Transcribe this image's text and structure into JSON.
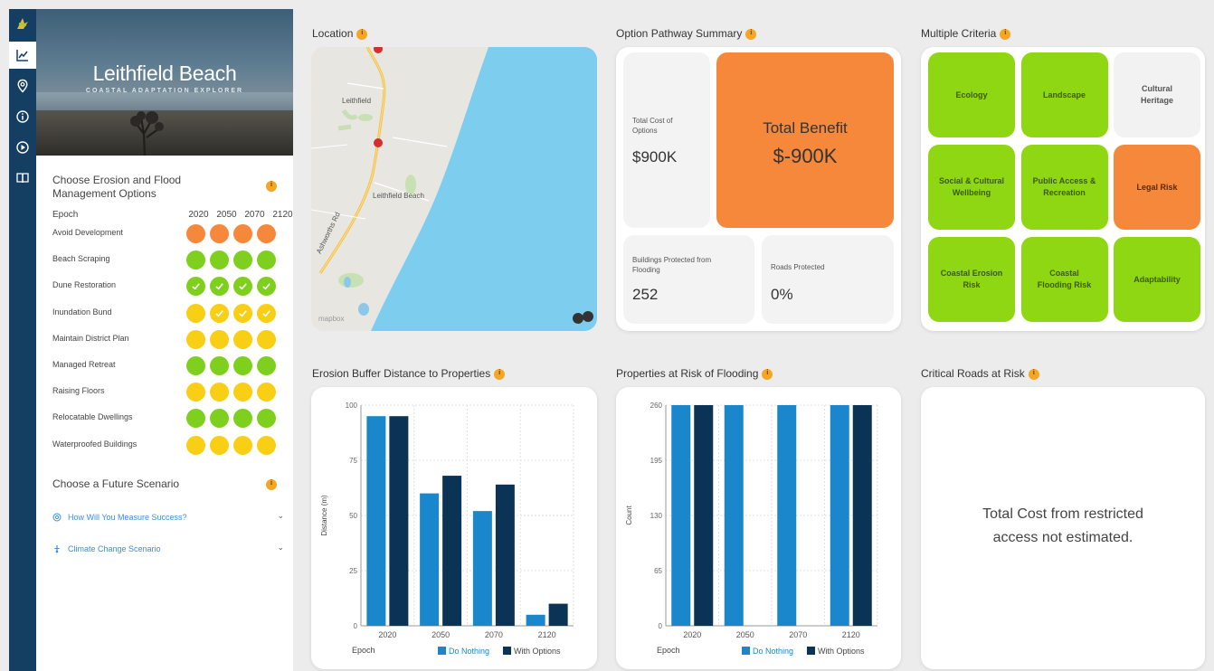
{
  "app": {
    "title": "Leithfield Beach",
    "subtitle": "COASTAL ADAPTATION EXPLORER"
  },
  "rail": {
    "icons": [
      "logo-icon",
      "chart-icon",
      "location-pin-icon",
      "info-icon",
      "play-icon",
      "book-icon"
    ],
    "active": "chart-icon"
  },
  "options_section": {
    "title_line1": "Choose Erosion and Flood",
    "title_line2": "Management Options",
    "epoch_label": "Epoch",
    "epochs": [
      "2020",
      "2050",
      "2070",
      "2120"
    ],
    "rows": [
      {
        "label": "Avoid Development",
        "dots": [
          "orange",
          "orange",
          "orange",
          "orange"
        ],
        "checked": [
          false,
          false,
          false,
          false
        ]
      },
      {
        "label": "Beach Scraping",
        "dots": [
          "green",
          "green",
          "green",
          "green"
        ],
        "checked": [
          false,
          false,
          false,
          false
        ]
      },
      {
        "label": "Dune Restoration",
        "dots": [
          "green",
          "green",
          "green",
          "green"
        ],
        "checked": [
          true,
          true,
          true,
          true
        ]
      },
      {
        "label": "Inundation Bund",
        "dots": [
          "yellow",
          "yellow",
          "yellow",
          "yellow"
        ],
        "checked": [
          false,
          true,
          true,
          true
        ]
      },
      {
        "label": "Maintain District Plan",
        "dots": [
          "yellow",
          "yellow",
          "yellow",
          "yellow"
        ],
        "checked": [
          false,
          false,
          false,
          false
        ]
      },
      {
        "label": "Managed Retreat",
        "dots": [
          "green",
          "green",
          "green",
          "green"
        ],
        "checked": [
          false,
          false,
          false,
          false
        ]
      },
      {
        "label": "Raising Floors",
        "dots": [
          "yellow",
          "yellow",
          "yellow",
          "yellow"
        ],
        "checked": [
          false,
          false,
          false,
          false
        ]
      },
      {
        "label": "Relocatable Dwellings",
        "dots": [
          "green",
          "green",
          "green",
          "green"
        ],
        "checked": [
          false,
          false,
          false,
          false
        ]
      },
      {
        "label": "Waterproofed Buildings",
        "dots": [
          "yellow",
          "yellow",
          "yellow",
          "yellow"
        ],
        "checked": [
          false,
          false,
          false,
          false
        ]
      }
    ],
    "colors": {
      "orange": "#f5883b",
      "green": "#7fcf1f",
      "yellow": "#f8cf14"
    }
  },
  "scenario_section": {
    "title": "Choose a Future Scenario",
    "items": [
      {
        "label": "How Will You Measure Success?",
        "icon": "target-icon"
      },
      {
        "label": "Climate Change Scenario",
        "icon": "thermometer-icon"
      }
    ]
  },
  "location": {
    "title": "Location",
    "places": [
      "Leithfield",
      "Leithfield Beach",
      "Ashworths Rd"
    ],
    "attribution": "mapbox"
  },
  "summary": {
    "title": "Option Pathway Summary",
    "total_cost_label": "Total Cost of Options",
    "total_cost_value": "$900K",
    "total_benefit_label": "Total Benefit",
    "total_benefit_value": "$-900K",
    "buildings_label": "Buildings Protected from Flooding",
    "buildings_value": "252",
    "roads_label": "Roads Protected",
    "roads_value": "0%"
  },
  "criteria": {
    "title": "Multiple Criteria",
    "items": [
      {
        "label": "Ecology",
        "status": "green"
      },
      {
        "label": "Landscape",
        "status": "green"
      },
      {
        "label": "Cultural Heritage",
        "status": "neutral"
      },
      {
        "label": "Social & Cultural Wellbeing",
        "status": "green"
      },
      {
        "label": "Public Access & Recreation",
        "status": "green"
      },
      {
        "label": "Legal Risk",
        "status": "orange"
      },
      {
        "label": "Coastal Erosion Risk",
        "status": "green"
      },
      {
        "label": "Coastal Flooding Risk",
        "status": "green"
      },
      {
        "label": "Adaptability",
        "status": "green"
      }
    ]
  },
  "erosion_chart_title": "Erosion Buffer Distance to Properties",
  "flooding_chart_title": "Properties at Risk of Flooding",
  "roads": {
    "title": "Critical Roads at Risk",
    "message_line1": "Total Cost from restricted",
    "message_line2": "access not estimated."
  },
  "chart_data": [
    {
      "type": "bar",
      "categories": [
        "2020",
        "2050",
        "2070",
        "2120"
      ],
      "series": [
        {
          "name": "Do Nothing",
          "values": [
            95,
            60,
            52,
            5
          ],
          "color": "#1a87cc"
        },
        {
          "name": "With Options",
          "values": [
            95,
            68,
            64,
            10
          ],
          "color": "#0b3355"
        }
      ],
      "xlabel": "Epoch",
      "ylabel": "Distance (m)",
      "ylim": [
        0,
        100
      ],
      "yticks": [
        0,
        25,
        50,
        75,
        100
      ],
      "legend": "bottom-right",
      "grid": true
    },
    {
      "type": "bar",
      "categories": [
        "2020",
        "2050",
        "2070",
        "2120"
      ],
      "series": [
        {
          "name": "Do Nothing",
          "values": [
            260,
            260,
            260,
            260
          ],
          "color": "#1a87cc"
        },
        {
          "name": "With Options",
          "values": [
            260,
            0,
            0,
            260
          ],
          "color": "#0b3355"
        }
      ],
      "xlabel": "Epoch",
      "ylabel": "Count",
      "ylim": [
        0,
        260
      ],
      "yticks": [
        0,
        65,
        130,
        195,
        260
      ],
      "legend": "bottom-right",
      "grid": true
    }
  ]
}
